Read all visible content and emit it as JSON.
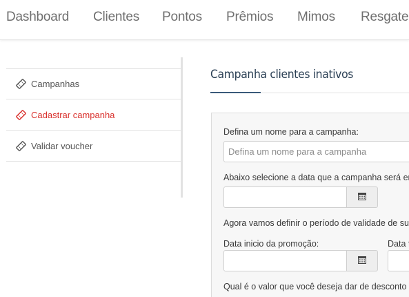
{
  "nav": {
    "items": [
      {
        "label": "Dashboard"
      },
      {
        "label": "Clientes"
      },
      {
        "label": "Pontos"
      },
      {
        "label": "Prêmios"
      },
      {
        "label": "Mimos"
      },
      {
        "label": "Resgates"
      }
    ]
  },
  "sidebar": {
    "items": [
      {
        "label": "Campanhas",
        "icon": "ticket-icon",
        "active": false
      },
      {
        "label": "Cadastrar campanha",
        "icon": "ticket-icon",
        "active": true
      },
      {
        "label": "Validar voucher",
        "icon": "ticket-icon",
        "active": false
      }
    ]
  },
  "page": {
    "title": "Campanha clientes inativos"
  },
  "form": {
    "name_label": "Defina um nome para a campanha:",
    "name_placeholder": "Defina um nome para a campanha",
    "send_date_label": "Abaixo selecione a data que a campanha será en",
    "validity_label": "Agora vamos definir o período de validade de su",
    "start_label": "Data inicio da promoção:",
    "end_label": "Data f",
    "discount_label": "Qual é o valor que você deseja dar de desconto p"
  },
  "colors": {
    "active": "#d9302c",
    "title": "#2a3f54",
    "accent": "#3a5a7a"
  }
}
